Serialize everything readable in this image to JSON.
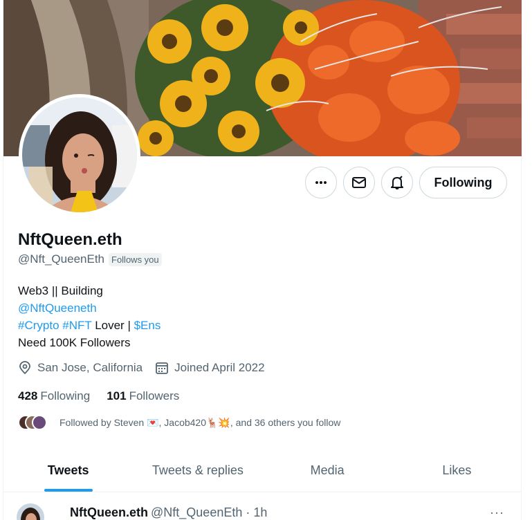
{
  "profile": {
    "display_name": "NftQueen.eth",
    "handle": "@Nft_QueenEth",
    "follows_you_badge": "Follows you",
    "bio_line1": "Web3 || Building",
    "bio_mention": "@NftQueeneth",
    "bio_tag_crypto": "#Crypto",
    "bio_tag_nft": "#NFT",
    "bio_lover": " Lover | ",
    "bio_cashtag": "$Ens",
    "bio_line4": "Need 100K Followers",
    "location": "San Jose, California",
    "joined": "Joined April 2022",
    "following_count": "428",
    "following_label": "Following",
    "followers_count": "101",
    "followers_label": "Followers",
    "followed_by": "Followed by Steven 💌, Jacob420🦌💥, and 36 others you follow"
  },
  "actions": {
    "more_icon": "more-icon",
    "message_icon": "mail-icon",
    "notify_icon": "bell-icon",
    "following_button": "Following"
  },
  "tabs": [
    {
      "label": "Tweets",
      "active": true
    },
    {
      "label": "Tweets & replies",
      "active": false
    },
    {
      "label": "Media",
      "active": false
    },
    {
      "label": "Likes",
      "active": false
    }
  ],
  "tweet": {
    "name": "NftQueen.eth",
    "handle_time": "@Nft_QueenEth · 1h",
    "more": "···"
  },
  "colors": {
    "accent": "#1d9bf0",
    "text": "#0f1419",
    "secondary": "#536471"
  }
}
